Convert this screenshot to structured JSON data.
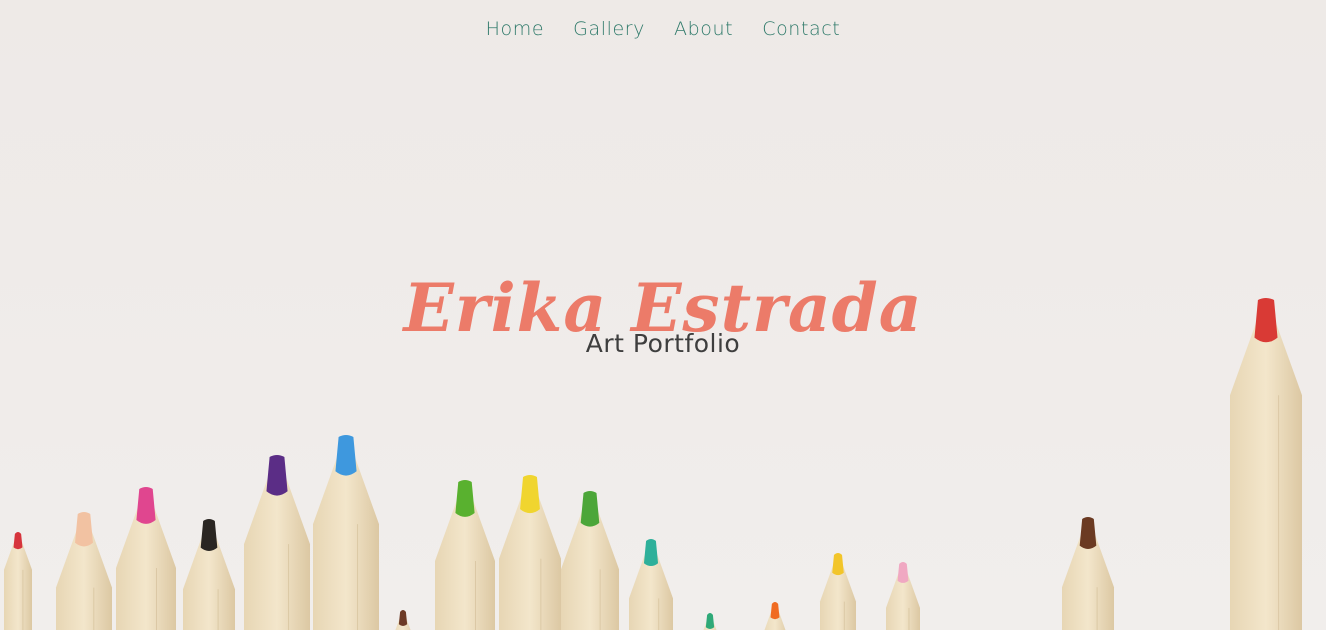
{
  "nav": {
    "items": [
      {
        "id": "home",
        "label": "Home"
      },
      {
        "id": "gallery",
        "label": "Gallery"
      },
      {
        "id": "about",
        "label": "About"
      },
      {
        "id": "contact",
        "label": "Contact"
      }
    ]
  },
  "hero": {
    "title": "Erika Estrada",
    "subtitle": "Art Portfolio",
    "background_image": "colored-pencils"
  },
  "colors": {
    "nav": "#2f7a6a",
    "title": "#ec7b69",
    "subtitle": "#3e3e3e",
    "background": "#eeeae7"
  }
}
